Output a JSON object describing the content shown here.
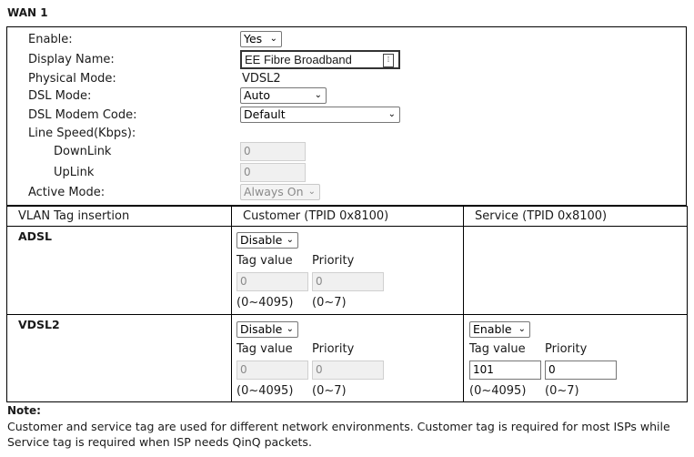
{
  "title": "WAN 1",
  "form": {
    "enable_label": "Enable:",
    "enable_value": "Yes",
    "display_name_label": "Display Name:",
    "display_name_value": "EE Fibre Broadband",
    "physical_mode_label": "Physical Mode:",
    "physical_mode_value": "VDSL2",
    "dsl_mode_label": "DSL Mode:",
    "dsl_mode_value": "Auto",
    "dsl_modem_code_label": "DSL Modem Code:",
    "dsl_modem_code_value": "Default",
    "line_speed_label": "Line Speed(Kbps):",
    "downlink_label": "DownLink",
    "downlink_value": "0",
    "uplink_label": "UpLink",
    "uplink_value": "0",
    "active_mode_label": "Active Mode:",
    "active_mode_value": "Always On"
  },
  "vlan": {
    "col_header": "VLAN Tag insertion",
    "customer_header": "Customer (TPID 0x8100)",
    "service_header": "Service (TPID 0x8100)",
    "tag_value_label": "Tag value",
    "priority_label": "Priority",
    "tag_range": "(0~4095)",
    "priority_range": "(0~7)",
    "adsl": {
      "label": "ADSL",
      "customer_state": "Disable",
      "customer_tag": "0",
      "customer_priority": "0"
    },
    "vdsl2": {
      "label": "VDSL2",
      "customer_state": "Disable",
      "customer_tag": "0",
      "customer_priority": "0",
      "service_state": "Enable",
      "service_tag": "101",
      "service_priority": "0"
    }
  },
  "note": {
    "heading": "Note:",
    "text": "Customer and service tag are used for different network environments. Customer tag is required for most ISPs while Service tag is required when ISP needs QinQ packets."
  }
}
